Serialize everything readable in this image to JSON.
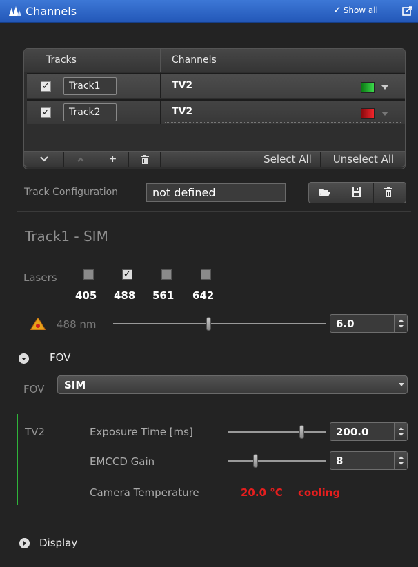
{
  "titlebar": {
    "title": "Channels",
    "show_all": "Show all"
  },
  "track_table": {
    "headers": {
      "tracks": "Tracks",
      "channels": "Channels"
    },
    "rows": [
      {
        "name": "Track1",
        "checked": true,
        "channel": "TV2",
        "color": "#1fb12a",
        "selected": true
      },
      {
        "name": "Track2",
        "checked": true,
        "channel": "TV2",
        "color": "#c8141a",
        "selected": false
      }
    ],
    "buttons": {
      "select_all": "Select All",
      "unselect_all": "Unselect All"
    }
  },
  "track_config": {
    "label": "Track Configuration",
    "value": "not defined"
  },
  "track_heading": "Track1 - SIM",
  "lasers": {
    "label": "Lasers",
    "wavelengths": [
      {
        "nm": "405",
        "checked": false
      },
      {
        "nm": "488",
        "checked": true
      },
      {
        "nm": "561",
        "checked": false
      },
      {
        "nm": "642",
        "checked": false
      }
    ],
    "active": {
      "label": "488 nm",
      "power": "6.0",
      "level": 0.45
    }
  },
  "fov": {
    "header": "FOV",
    "label": "FOV",
    "value": "SIM"
  },
  "channel": {
    "name": "TV2",
    "exposure": {
      "label": "Exposure Time [ms]",
      "value": "200.0",
      "level": 0.75
    },
    "gain": {
      "label": "EMCCD Gain",
      "value": "8",
      "level": 0.28
    },
    "temperature": {
      "label": "Camera Temperature",
      "value": "20.0 °C",
      "status": "cooling"
    }
  },
  "display": {
    "label": "Display"
  },
  "colors": {
    "titlebar": "#2b62c4",
    "warning": "#e8a21a",
    "alert": "#e51e1e"
  }
}
